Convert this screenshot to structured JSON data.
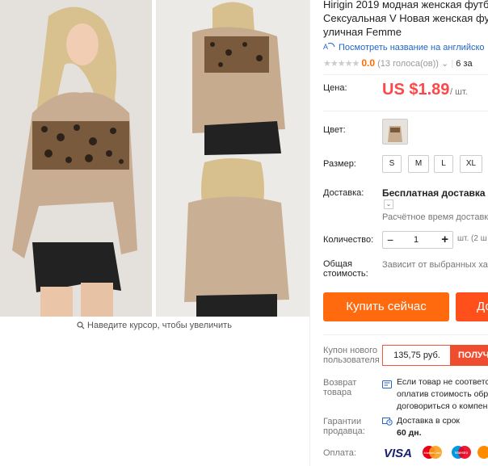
{
  "gallery": {
    "zoom_hint": "Наведите курсор, чтобы увеличить"
  },
  "product": {
    "title_lines": [
      "Hirigin 2019 модная женская футб",
      "Сексуальная V Новая женская фут",
      "уличная Femme"
    ],
    "translate_link": "Посмотреть название на английско",
    "rating_score": "0.0",
    "rating_votes": "(13 голоса(ов))",
    "orders_partial": "6 за"
  },
  "price": {
    "label": "Цена:",
    "value": "US $1.89",
    "unit": "/ шт."
  },
  "color": {
    "label": "Цвет:"
  },
  "sizes": {
    "label": "Размер:",
    "options": [
      "S",
      "M",
      "L",
      "XL"
    ]
  },
  "shipping": {
    "label": "Доставка:",
    "free": "Бесплатная доставка в R",
    "estimated": "Расчётное время доставки"
  },
  "quantity": {
    "label": "Количество:",
    "value": "1",
    "minus": "−",
    "plus": "+",
    "hint": "шт. (2 ш"
  },
  "total": {
    "label_lines": [
      "Общая",
      "стоимость:"
    ],
    "value": "Зависит от выбранных хар"
  },
  "actions": {
    "buy_now": "Купить сейчас",
    "add_to_cart": "До"
  },
  "coupon": {
    "label_lines": [
      "Купон нового",
      "пользователя"
    ],
    "amount": "135,75 руб.",
    "get": "ПОЛУЧ"
  },
  "returns": {
    "label_lines": [
      "Возврат",
      "товара"
    ],
    "text_lines": [
      "Если товар не соответс",
      "оплатив стоимость обр",
      "договориться о компен"
    ]
  },
  "guarantee": {
    "label_lines": [
      "Гарантии",
      "продавца:"
    ],
    "text": "Доставка в срок",
    "days": "60 дн."
  },
  "payment": {
    "label": "Оплата:",
    "methods": [
      "VISA",
      "MasterCard",
      "Maestro",
      "Qiwi"
    ]
  },
  "colors": {
    "accent": "#ff6a00",
    "price": "#ff4747",
    "buy": "#ff6a0e",
    "link": "#2266c6"
  }
}
